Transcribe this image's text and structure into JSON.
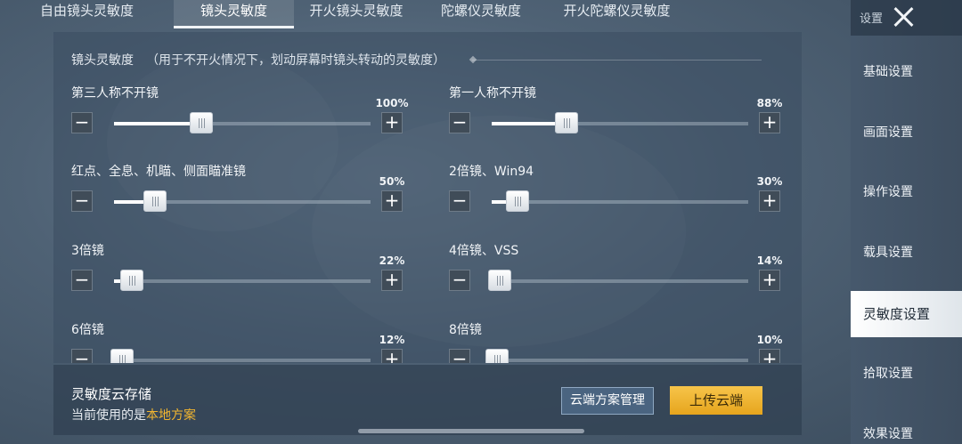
{
  "tabs": [
    {
      "label": "自由镜头灵敏度",
      "active": false
    },
    {
      "label": "镜头灵敏度",
      "active": true
    },
    {
      "label": "开火镜头灵敏度",
      "active": false
    },
    {
      "label": "陀螺仪灵敏度",
      "active": false
    },
    {
      "label": "开火陀螺仪灵敏度",
      "active": false
    }
  ],
  "section": {
    "title": "镜头灵敏度",
    "note": "（用于不开火情况下，划动屏幕时镜头转动的灵敏度）"
  },
  "controls": {
    "minus": "−",
    "plus": "+"
  },
  "sliders": [
    {
      "label": "第三人称不开镜",
      "value": "100%",
      "level": 0.34
    },
    {
      "label": "第一人称不开镜",
      "value": "88%",
      "level": 0.29
    },
    {
      "label": "红点、全息、机瞄、侧面瞄准镜",
      "value": "50%",
      "level": 0.16
    },
    {
      "label": "2倍镜、Win94",
      "value": "30%",
      "level": 0.1
    },
    {
      "label": "3倍镜",
      "value": "22%",
      "level": 0.07
    },
    {
      "label": "4倍镜、VSS",
      "value": "14%",
      "level": 0.03
    },
    {
      "label": "6倍镜",
      "value": "12%",
      "level": 0.03
    },
    {
      "label": "8倍镜",
      "value": "10%",
      "level": 0.02
    }
  ],
  "cloud": {
    "title": "灵敏度云存储",
    "current_prefix": "当前使用的是",
    "current_plan": "本地方案",
    "manage_label": "云端方案管理",
    "upload_label": "上传云端"
  },
  "sidebar": {
    "title": "设置",
    "items": [
      {
        "label": "基础设置",
        "active": false
      },
      {
        "label": "画面设置",
        "active": false
      },
      {
        "label": "操作设置",
        "active": false
      },
      {
        "label": "载具设置",
        "active": false
      },
      {
        "label": "灵敏度设置",
        "active": true
      },
      {
        "label": "拾取设置",
        "active": false
      },
      {
        "label": "效果设置",
        "active": false
      }
    ]
  },
  "colors": {
    "accent_gold": "#f2b630",
    "upload_button": "#f0b93a"
  }
}
